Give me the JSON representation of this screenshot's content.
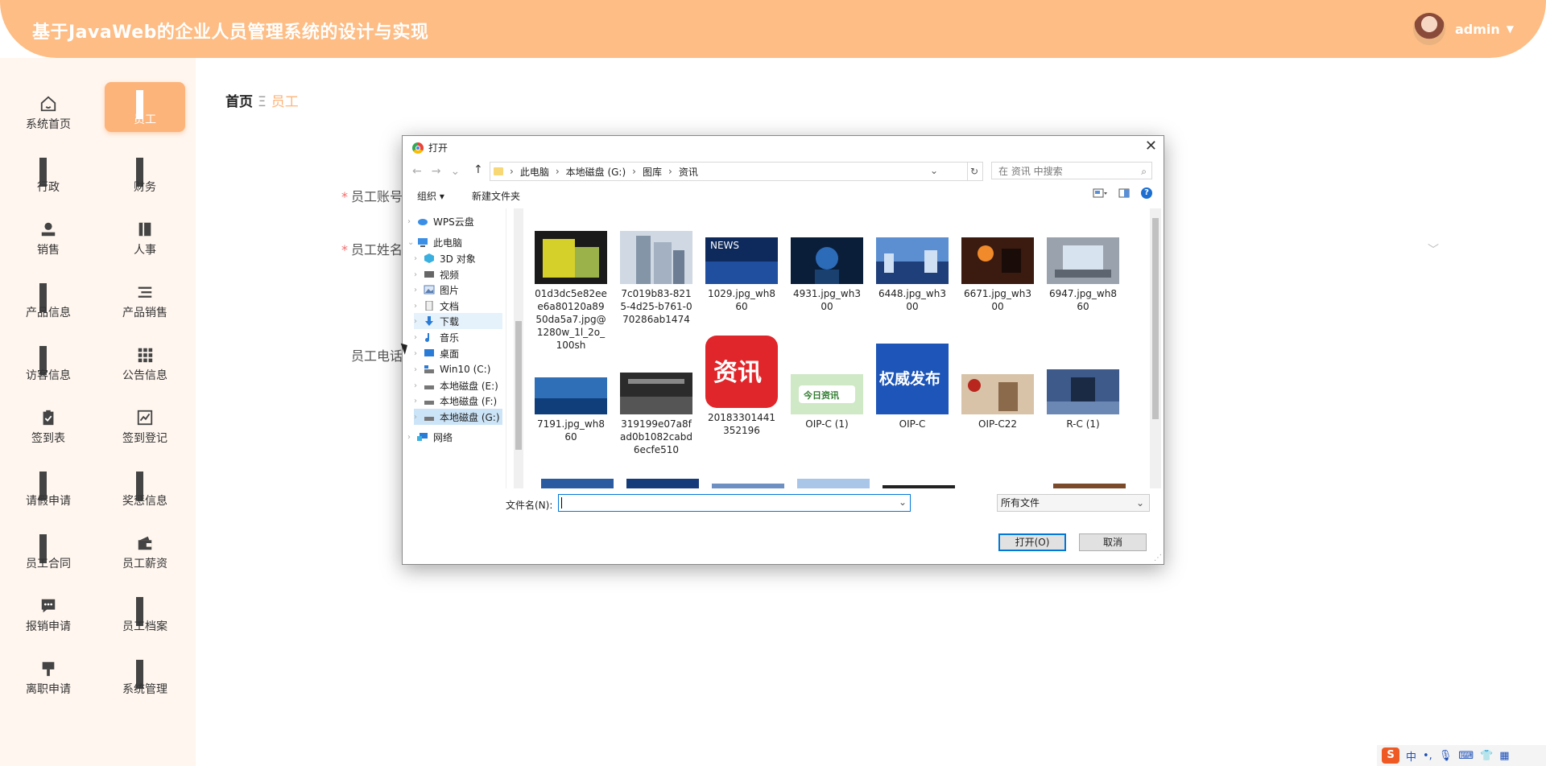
{
  "header": {
    "title": "基于JavaWeb的企业人员管理系统的设计与实现",
    "username": "admin"
  },
  "sidebar": {
    "items": [
      {
        "label": "系统首页",
        "icon": "home-icon"
      },
      {
        "label": "员工",
        "icon": "grid-icon",
        "active": true
      },
      {
        "label": "行政",
        "icon": "grid-icon"
      },
      {
        "label": "财务",
        "icon": "grid-icon"
      },
      {
        "label": "销售",
        "icon": "user-icon"
      },
      {
        "label": "人事",
        "icon": "book-icon"
      },
      {
        "label": "产品信息",
        "icon": "grid-icon"
      },
      {
        "label": "产品销售",
        "icon": "list-icon"
      },
      {
        "label": "访客信息",
        "icon": "grid-icon"
      },
      {
        "label": "公告信息",
        "icon": "dots-grid-icon"
      },
      {
        "label": "签到表",
        "icon": "clipboard-check-icon"
      },
      {
        "label": "签到登记",
        "icon": "chart-line-icon"
      },
      {
        "label": "请假申请",
        "icon": "grid-icon"
      },
      {
        "label": "奖惩信息",
        "icon": "grid-icon"
      },
      {
        "label": "员工合同",
        "icon": "grid-icon"
      },
      {
        "label": "员工薪资",
        "icon": "wallet-icon"
      },
      {
        "label": "报销申请",
        "icon": "message-icon"
      },
      {
        "label": "员工档案",
        "icon": "grid-icon"
      },
      {
        "label": "离职申请",
        "icon": "flag-icon"
      },
      {
        "label": "系统管理",
        "icon": "grid-icon"
      }
    ]
  },
  "breadcrumb": {
    "home": "首页",
    "separator": "Ξ",
    "current": "员工"
  },
  "form": {
    "account_label": "员工账号",
    "name_label": "员工姓名",
    "phone_label": "员工电话"
  },
  "dialog": {
    "title": "打开",
    "path": [
      "此电脑",
      "本地磁盘 (G:)",
      "图库",
      "资讯"
    ],
    "search_placeholder": "在 资讯 中搜索",
    "organize": "组织 ▾",
    "new_folder": "新建文件夹",
    "tree": [
      {
        "label": "WPS云盘",
        "icon": "cloud-icon"
      },
      {
        "label": "此电脑",
        "icon": "computer-icon"
      },
      {
        "label": "3D 对象",
        "icon": "cube-icon"
      },
      {
        "label": "视频",
        "icon": "video-icon"
      },
      {
        "label": "图片",
        "icon": "picture-icon"
      },
      {
        "label": "文档",
        "icon": "document-icon"
      },
      {
        "label": "下载",
        "icon": "download-icon"
      },
      {
        "label": "音乐",
        "icon": "music-icon"
      },
      {
        "label": "桌面",
        "icon": "desktop-icon"
      },
      {
        "label": "Win10 (C:)",
        "icon": "drive-icon"
      },
      {
        "label": "本地磁盘 (E:)",
        "icon": "drive-icon"
      },
      {
        "label": "本地磁盘 (F:)",
        "icon": "drive-icon"
      },
      {
        "label": "本地磁盘 (G:)",
        "icon": "drive-icon"
      },
      {
        "label": "网络",
        "icon": "network-icon"
      }
    ],
    "files": [
      {
        "name": "01d3dc5e82eee6a80120a8950da5a7.jpg@1280w_1l_2o_100sh"
      },
      {
        "name": "7c019b83-8215-4d25-b761-070286ab1474"
      },
      {
        "name": "1029.jpg_wh860"
      },
      {
        "name": "4931.jpg_wh300"
      },
      {
        "name": "6448.jpg_wh300"
      },
      {
        "name": "6671.jpg_wh300"
      },
      {
        "name": "6947.jpg_wh860"
      },
      {
        "name": "7191.jpg_wh860"
      },
      {
        "name": "319199e07a8fad0b1082cabd6ecfe510"
      },
      {
        "name": "20183301441352196"
      },
      {
        "name": "OIP-C (1)"
      },
      {
        "name": "OIP-C"
      },
      {
        "name": "OIP-C22"
      },
      {
        "name": "R-C (1)"
      }
    ],
    "thumb_text": {
      "news": "NEWS",
      "zixun": "资讯",
      "jinri": "今日资讯",
      "quanwei": "权威发布"
    },
    "filename_label": "文件名(N):",
    "filetype": "所有文件",
    "open_button": "打开(O)",
    "cancel_button": "取消"
  },
  "tray": {
    "ime": "中"
  },
  "colors": {
    "accent": "#fdb47a",
    "header": "#fdbd85",
    "sidebar_bg": "#fff6ef"
  }
}
